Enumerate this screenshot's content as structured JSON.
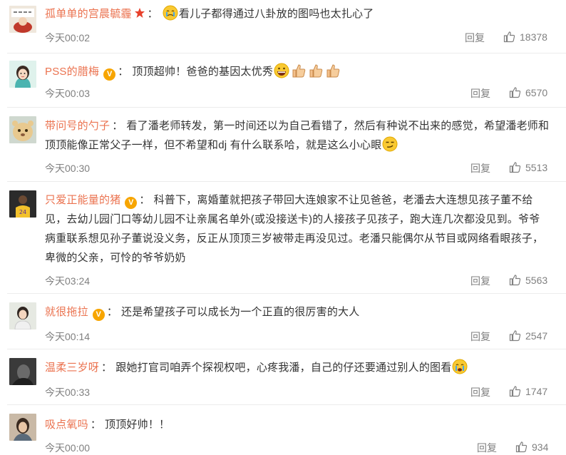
{
  "comments": [
    {
      "user": "孤单单的宫晨毓霾",
      "text": "看儿子都得通过八卦放的图吗也太扎心了",
      "time": "今天00:02",
      "reply_label": "回复",
      "likes": "18378"
    },
    {
      "user": "PSS的腊梅",
      "text": "顶顶超帅！爸爸的基因太优秀",
      "time": "今天00:03",
      "reply_label": "回复",
      "likes": "6570"
    },
    {
      "user": "带问号的勺子",
      "text": "看了潘老师转发，第一时间还以为自己看错了，然后有种说不出来的感觉，希望潘老师和顶顶能像正常父子一样，但不希望和dj 有什么联系哈，就是这么小心眼",
      "time": "今天00:30",
      "reply_label": "回复",
      "likes": "5513"
    },
    {
      "user": "只爱正能量的猪",
      "text": "科普下，离婚董就把孩子带回大连娘家不让见爸爸，老潘去大连想见孩子董不给见，去幼儿园门口等幼儿园不让亲属名单外(或没接送卡)的人接孩子见孩子，跑大连几次都没见到。爷爷病重联系想见孙子董说没义务，反正从顶顶三岁被带走再没见过。老潘只能偶尔从节目或网络看眼孩子，卑微的父亲，可怜的爷爷奶奶",
      "time": "今天03:24",
      "reply_label": "回复",
      "likes": "5563"
    },
    {
      "user": "就很拖拉",
      "text": "还是希望孩子可以成长为一个正直的很厉害的大人",
      "time": "今天00:14",
      "reply_label": "回复",
      "likes": "2547"
    },
    {
      "user": "温柔三岁呀",
      "text": "跟她打官司咱弄个探视权吧，心疼我潘，自己的仔还要通过别人的图看",
      "time": "今天00:33",
      "reply_label": "回复",
      "likes": "1747"
    },
    {
      "user": "吸点氧吗",
      "text": "顶顶好帅！！",
      "time": "今天00:00",
      "reply_label": "回复",
      "likes": "934"
    }
  ],
  "colors": {
    "username": "#eb7350",
    "meta": "#808080",
    "verified_badge": "#f7a500"
  }
}
